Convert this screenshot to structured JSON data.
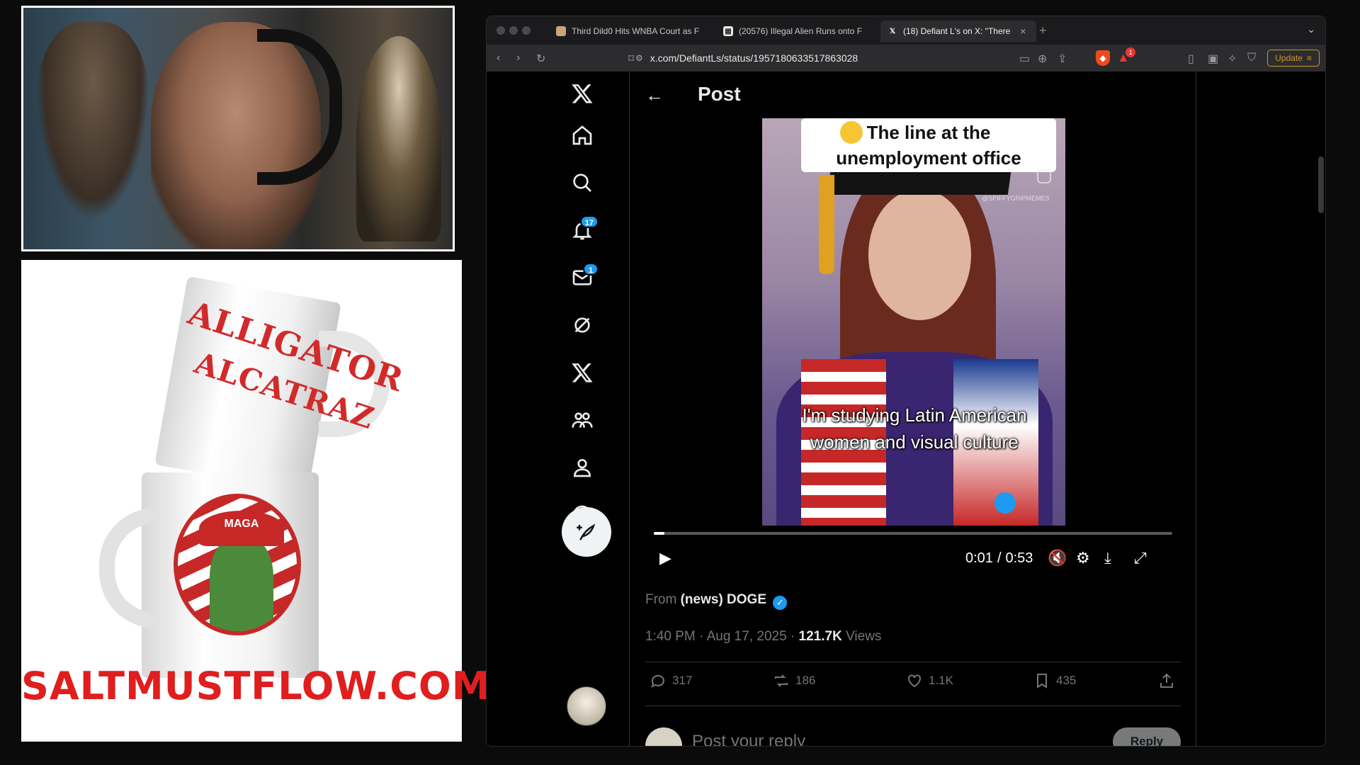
{
  "merch": {
    "mug_top_text_1": "ALLIGATOR",
    "mug_top_text_2": "ALCATRAZ",
    "cap_text": "MAGA",
    "site": "SALTMUSTFLOW.COM"
  },
  "browser": {
    "tabs": [
      {
        "label": "Third Dild0 Hits WNBA Court as F",
        "favicon": "game-favicon",
        "active": false
      },
      {
        "label": "(20576) Illegal Alien Runs onto F",
        "favicon": "grid-favicon",
        "active": false
      },
      {
        "label": "(18) Defiant L's on X: \"There",
        "favicon": "x-favicon",
        "active": true
      }
    ],
    "new_tab": "+",
    "url": "x.com/DefiantLs/status/1957180633517863028",
    "update_label": "Update",
    "alert_count": "1"
  },
  "x": {
    "nav": [
      {
        "name": "x-logo-icon"
      },
      {
        "name": "home-icon"
      },
      {
        "name": "search-icon"
      },
      {
        "name": "notifications-icon",
        "badge": "17"
      },
      {
        "name": "messages-icon",
        "badge": "1"
      },
      {
        "name": "grok-icon"
      },
      {
        "name": "premium-x-icon"
      },
      {
        "name": "communities-icon"
      },
      {
        "name": "profile-icon"
      },
      {
        "name": "more-icon"
      }
    ],
    "header_title": "Post",
    "video": {
      "caption": "The line at the unemployment office",
      "watermark": "@SPIFFYGRIPMEMES",
      "subtitle": "I'm studying Latin American women and visual culture",
      "current_time": "0:01",
      "duration": "0:53",
      "progress": 0.02
    },
    "from_label": "From",
    "from_account": "(news) DOGE",
    "timestamp": "1:40 PM · Aug 17, 2025 · ",
    "views_count": "121.7K",
    "views_label": "Views",
    "actions": {
      "replies": "317",
      "reposts": "186",
      "likes": "1.1K",
      "bookmarks": "435"
    },
    "reply_placeholder": "Post your reply",
    "reply_button": "Reply"
  },
  "colors": {
    "accent": "#1d9bf0",
    "brand_red": "#e01e1e",
    "text_primary": "#e7e9ea",
    "text_secondary": "#71767b"
  }
}
